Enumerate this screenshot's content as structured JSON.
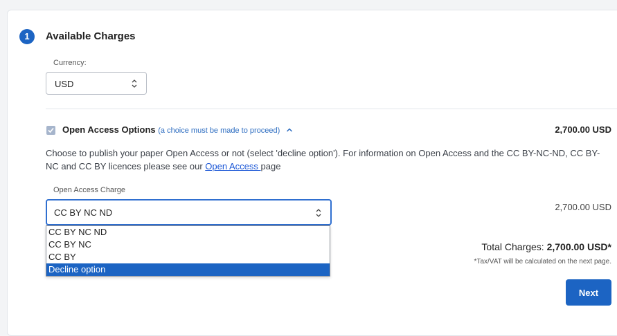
{
  "step": {
    "number": "1",
    "title": "Available Charges"
  },
  "currency": {
    "label": "Currency:",
    "value": "USD"
  },
  "open_access": {
    "title": "Open Access Options",
    "hint": "(a choice must be made to proceed)",
    "amount": "2,700.00 USD",
    "description_text": "Choose to publish your paper Open Access or not (select 'decline option'). For information on Open Access and the CC BY-NC-ND, CC BY-NC and CC BY licences please see our ",
    "description_link": "Open Access ",
    "description_end": "page",
    "checked": true
  },
  "charge": {
    "label": "Open Access Charge",
    "value": "CC BY NC ND",
    "amount": "2,700.00 USD",
    "options": [
      "CC BY NC ND",
      "CC BY NC",
      "CC BY",
      "Decline option"
    ],
    "highlighted_option": "Decline option"
  },
  "totals": {
    "label": "Total Charges:",
    "value": "2,700.00 USD*",
    "note": "*Tax/VAT will be calculated on the next page."
  },
  "next_button": "Next",
  "colors": {
    "accent": "#1c64c3",
    "link": "#1a56d6",
    "hint": "#2a6bc0"
  }
}
